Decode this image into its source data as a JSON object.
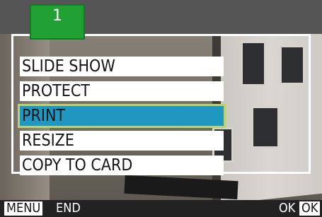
{
  "tab": {
    "label": "1"
  },
  "menu": {
    "items": [
      {
        "label": "SLIDE SHOW",
        "selected": false
      },
      {
        "label": "PROTECT",
        "selected": false
      },
      {
        "label": "PRINT",
        "selected": true
      },
      {
        "label": "RESIZE",
        "selected": false
      },
      {
        "label": "COPY TO CARD",
        "selected": false
      }
    ]
  },
  "bottom_bar": {
    "menu_key": "MENU",
    "menu_action": "END",
    "ok_action": "OK",
    "ok_key": "OK"
  },
  "colors": {
    "tab_green": "#21a033",
    "selected_blue": "#1f97c1",
    "selected_outline": "#b8d26e"
  }
}
